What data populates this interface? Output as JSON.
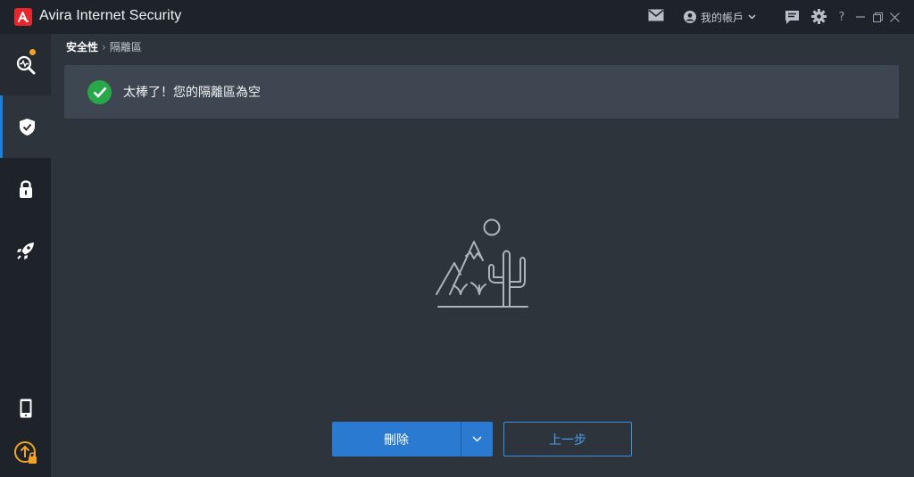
{
  "app": {
    "title": "Avira Internet Security",
    "account_label": "我的帳戶"
  },
  "titlebar": {
    "icons": [
      "mail-icon",
      "account-icon",
      "feedback-icon",
      "gear-icon",
      "help-icon"
    ],
    "help_glyph": "?",
    "window_controls": [
      "minimize-icon",
      "restore-icon",
      "close-icon"
    ]
  },
  "sidebar": {
    "items": [
      {
        "name": "status",
        "icon": "magnifier-pulse-icon",
        "has_badge": true
      },
      {
        "name": "security",
        "icon": "shield-check-icon",
        "active": true
      },
      {
        "name": "privacy",
        "icon": "lock-icon"
      },
      {
        "name": "performance",
        "icon": "rocket-icon"
      },
      {
        "name": "mobile",
        "icon": "phone-icon"
      },
      {
        "name": "upgrade",
        "icon": "upgrade-arrow-icon"
      }
    ]
  },
  "breadcrumb": {
    "parent": "安全性",
    "separator": "›",
    "current": "隔離區"
  },
  "banner": {
    "message": "太棒了！您的隔離區為空",
    "status_color": "#29a84a"
  },
  "empty_state": {
    "icon": "desert-landscape-icon"
  },
  "actions": {
    "delete_label": "刪除",
    "back_label": "上一步",
    "accent": "#2b7ad1"
  }
}
